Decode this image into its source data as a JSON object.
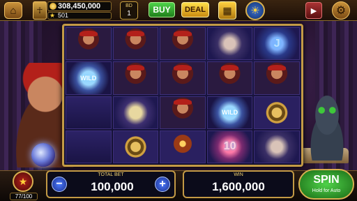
{
  "topbar": {
    "coins": "308,450,000",
    "level": "501",
    "bd_label": "BD",
    "bd_count": "1",
    "buy_label": "BUY",
    "deal_label": "DEAL"
  },
  "reels": {
    "symbols": [
      [
        "fortune",
        "fortune",
        "fortune",
        "hand",
        "j"
      ],
      [
        "wild",
        "fortune",
        "fortune",
        "fortune",
        "fortune"
      ],
      [
        "",
        "cards",
        "fortune",
        "wild",
        "medallion"
      ],
      [
        "",
        "medallion",
        "candle",
        "ten",
        "hand"
      ]
    ],
    "wild_text": "WILD",
    "j_text": "J",
    "ten_text": "10"
  },
  "bottombar": {
    "meter_count": "77/100",
    "total_bet_label": "TOTAL BET",
    "total_bet_value": "100,000",
    "win_label": "WIN",
    "win_value": "1,600,000",
    "spin_label": "SPIN",
    "spin_sub": "Hold for Auto"
  },
  "icons": {
    "home": "home-icon",
    "avatar": "pharaoh-avatar-icon",
    "coin": "coin-icon",
    "star": "star-icon",
    "grid": "grid-icon",
    "sun": "sun-icon",
    "video": "video-icon",
    "gear": "gear-icon"
  }
}
